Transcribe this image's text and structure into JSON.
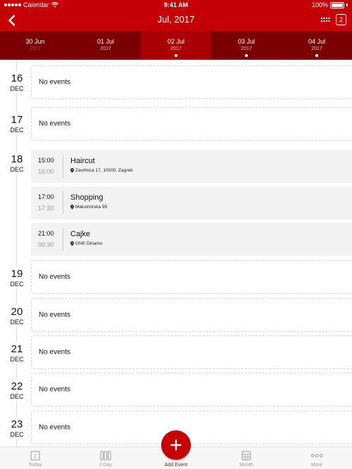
{
  "status_bar": {
    "carrier": "Calendar",
    "time": "9:41 AM",
    "battery": "100%"
  },
  "nav": {
    "title": "Jul, 2017",
    "badge": "2"
  },
  "date_strip": [
    {
      "day": "30 Jun",
      "year": "2017"
    },
    {
      "day": "01 Jul",
      "year": "2017"
    },
    {
      "day": "02 Jul",
      "year": "2017"
    },
    {
      "day": "03 Jul",
      "year": "2017"
    },
    {
      "day": "04 Jul",
      "year": "2017"
    }
  ],
  "no_events_label": "No events",
  "days": [
    {
      "num": "16",
      "month": "DEC"
    },
    {
      "num": "17",
      "month": "DEC"
    },
    {
      "num": "18",
      "month": "DEC"
    },
    {
      "num": "19",
      "month": "DEC"
    },
    {
      "num": "20",
      "month": "DEC"
    },
    {
      "num": "21",
      "month": "DEC"
    },
    {
      "num": "22",
      "month": "DEC"
    },
    {
      "num": "23",
      "month": "DEC"
    }
  ],
  "events": [
    {
      "start": "15:00",
      "end": "16:00",
      "title": "Haircut",
      "location": "Zavrtnica 17, 10000, Zagreb"
    },
    {
      "start": "17:00",
      "end": "17:30",
      "title": "Shopping",
      "location": "Maksimirska 99"
    },
    {
      "start": "21:00",
      "end": "00:30",
      "title": "Cajke",
      "location": "GNK Dinamo"
    }
  ],
  "tabs": {
    "today": "Today",
    "today_icon_num": "2",
    "three_day": "3 Day",
    "add_event": "Add Event",
    "month": "Month",
    "more": "More"
  },
  "colors": {
    "accent": "#c40006",
    "strip_dark": "#7a0003",
    "strip_selected": "#a80005"
  }
}
